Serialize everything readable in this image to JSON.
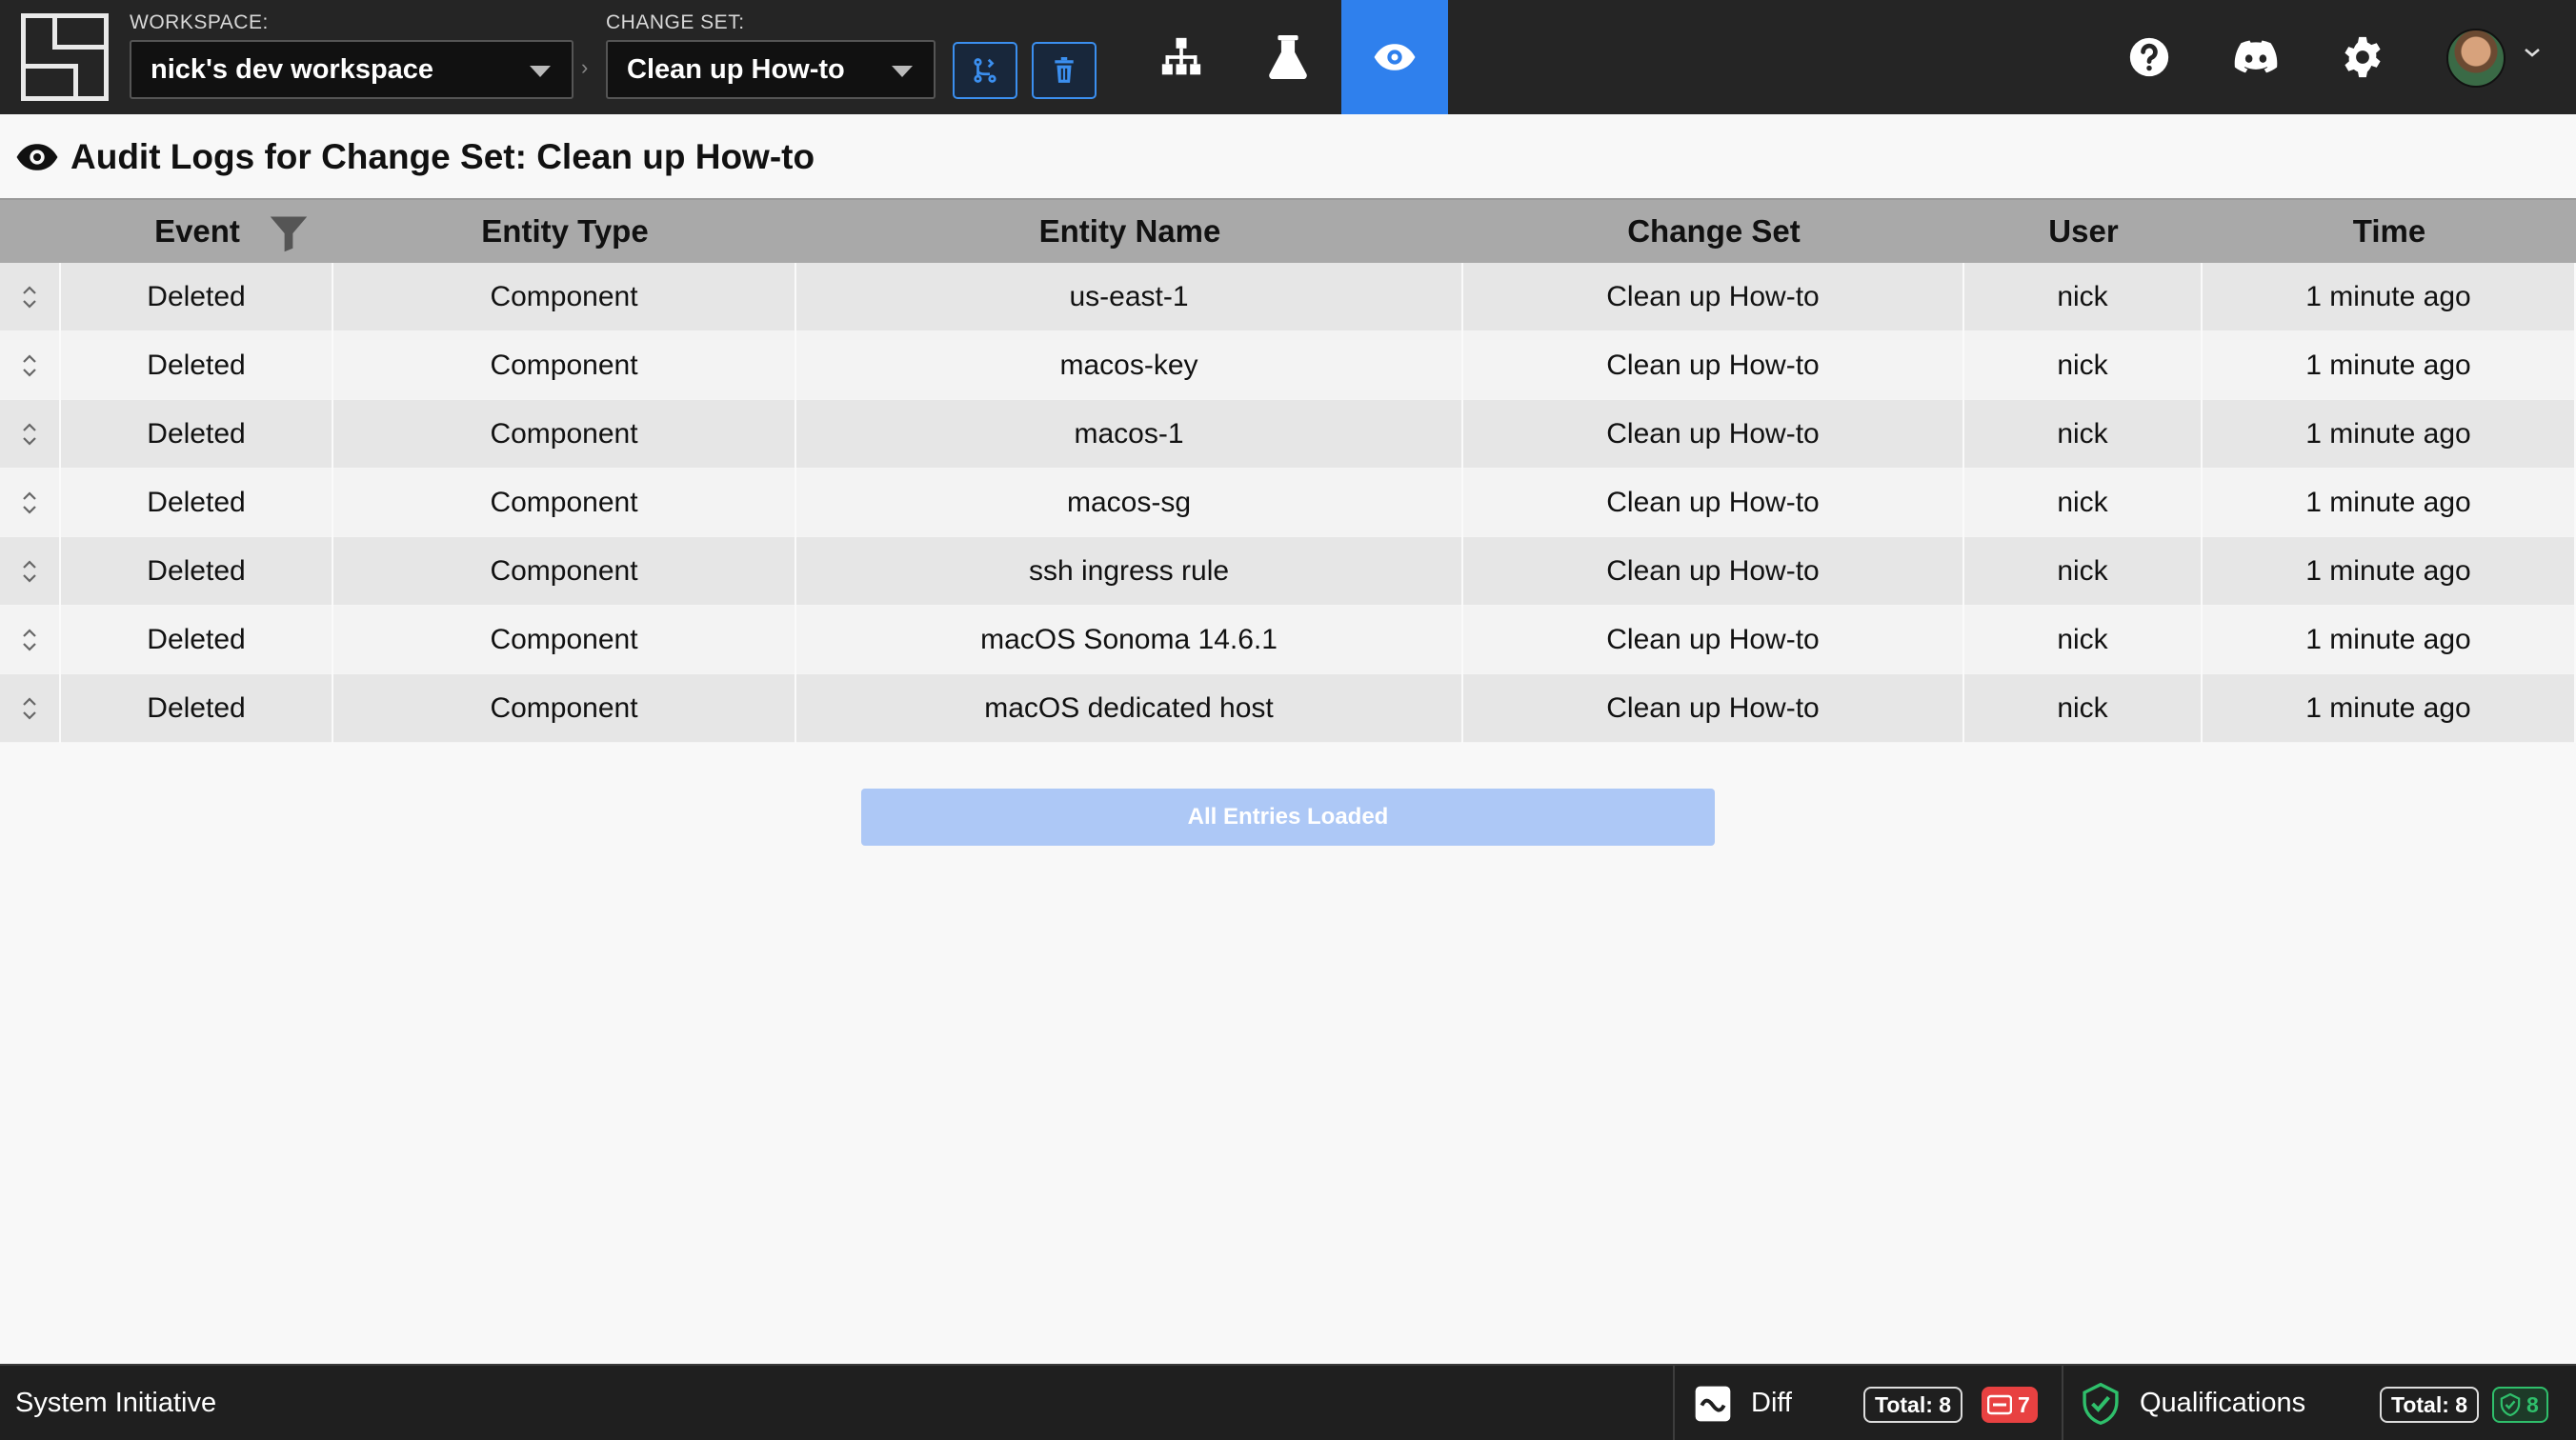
{
  "header": {
    "workspace_label": "WORKSPACE:",
    "workspace_value": "nick's dev workspace",
    "changeset_label": "CHANGE SET:",
    "changeset_value": "Clean up How-to"
  },
  "page": {
    "title": "Audit Logs for Change Set: Clean up How-to"
  },
  "table": {
    "columns": [
      "Event",
      "Entity Type",
      "Entity Name",
      "Change Set",
      "User",
      "Time"
    ],
    "rows": [
      [
        "Deleted",
        "Component",
        "us-east-1",
        "Clean up How-to",
        "nick",
        "1 minute ago"
      ],
      [
        "Deleted",
        "Component",
        "macos-key",
        "Clean up How-to",
        "nick",
        "1 minute ago"
      ],
      [
        "Deleted",
        "Component",
        "macos-1",
        "Clean up How-to",
        "nick",
        "1 minute ago"
      ],
      [
        "Deleted",
        "Component",
        "macos-sg",
        "Clean up How-to",
        "nick",
        "1 minute ago"
      ],
      [
        "Deleted",
        "Component",
        "ssh ingress rule",
        "Clean up How-to",
        "nick",
        "1 minute ago"
      ],
      [
        "Deleted",
        "Component",
        "macOS Sonoma 14.6.1",
        "Clean up How-to",
        "nick",
        "1 minute ago"
      ],
      [
        "Deleted",
        "Component",
        "macOS dedicated host",
        "Clean up How-to",
        "nick",
        "1 minute ago"
      ]
    ]
  },
  "loaded_button": "All Entries Loaded",
  "status": {
    "brand": "System Initiative",
    "diff_label": "Diff",
    "diff_total": "Total:  8",
    "diff_deleted": "7",
    "qual_label": "Qualifications",
    "qual_total": "Total:  8",
    "qual_ok": "8"
  },
  "colors": {
    "accent": "#2f80ed",
    "topbar": "#252525",
    "deleted": "#e84141",
    "success": "#2fbf6b"
  }
}
